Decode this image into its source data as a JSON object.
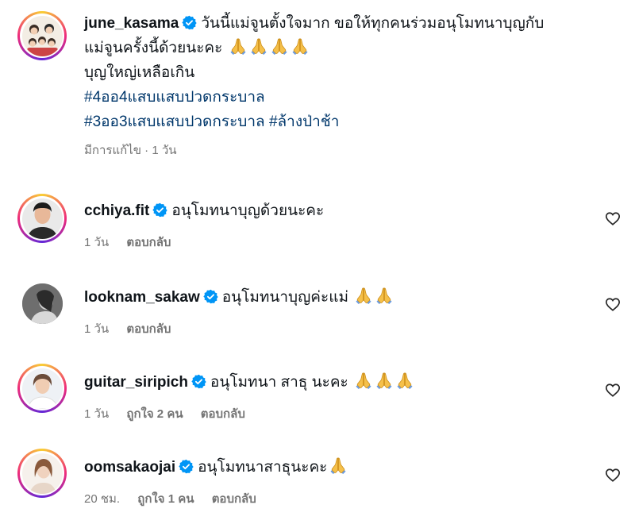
{
  "post": {
    "username": "june_kasama",
    "text_line1": "วันนี้แม่จูนตั้งใจมาก ขอให้ทุกคนร่วมอนุโมทนาบุญกับ",
    "text_line2": "แม่จูนครั้งนี้ด้วยนะคะ",
    "text_line3": "บุญใหญ่เหลือเกิน",
    "hashtag1": "#4ออ4แสบแสบปวดกระบาล",
    "hashtag2": "#3ออ3แสบแสบปวดกระบาล",
    "hashtag3": "#ล้างป่าช้า",
    "meta": "มีการแก้ไข · 1 วัน",
    "pray_count": 4
  },
  "comments": [
    {
      "username": "cchiya.fit",
      "text": "อนุโมทนาบุญด้วยนะคะ",
      "time": "1 วัน",
      "likes": "",
      "reply": "ตอบกลับ",
      "pray_count": 0
    },
    {
      "username": "looknam_sakaw",
      "text": "อนุโมทนาบุญค่ะแม่",
      "time": "1 วัน",
      "likes": "",
      "reply": "ตอบกลับ",
      "pray_count": 2
    },
    {
      "username": "guitar_siripich",
      "text": "อนุโมทนา สาธุ นะคะ",
      "time": "1 วัน",
      "likes": "ถูกใจ 2 คน",
      "reply": "ตอบกลับ",
      "pray_count": 3
    },
    {
      "username": "oomsakaojai",
      "text": "อนุโมทนาสาธุนะคะ",
      "time": "20 ชม.",
      "likes": "ถูกใจ 1 คน",
      "reply": "ตอบกลับ",
      "pray_count": 1
    }
  ],
  "colors": {
    "verified": "#0095f6",
    "hashtag": "#00376b",
    "meta": "#737373"
  },
  "icons": {
    "verified": "verified-badge-icon",
    "heart": "heart-outline-icon",
    "pray": "folded-hands-emoji"
  }
}
